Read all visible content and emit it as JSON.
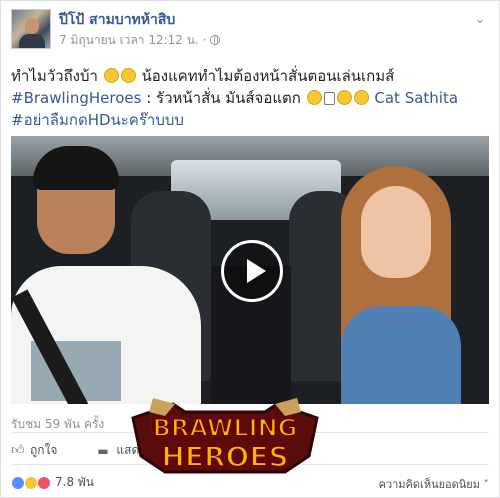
{
  "post": {
    "author": "ปีโป้ สามบาทห้าสิบ",
    "timestamp": "7 มิถุนายน เวลา 12:12 น. ·",
    "text": {
      "part1": "ทำไมวัวถึงบ้า ",
      "part2": " น้องแคททำไมต้องหน้าสั่นตอนเล่นเกมส์",
      "hashtag1": "#BrawlingHeroes",
      "part3": " : รัวหน้าสั่น มันส์จอแตก ",
      "mention": "Cat Sathita",
      "hashtag2": "#อย่าลืมกดHDนะคร๊าบบบ"
    }
  },
  "video": {
    "views": "รับชม 59 พัน ครั้ง"
  },
  "actions": {
    "like_label": "ถูกใจ",
    "share_label": "แสดง"
  },
  "reactions": {
    "count": "7.8 พัน"
  },
  "comments": {
    "sort_label": "ความคิดเห็นยอดนิยม ˅"
  },
  "banner": {
    "line1": "BRAWLING",
    "line2": "HEROES"
  },
  "colors": {
    "link": "#365899",
    "meta": "#90949c",
    "banner_gold": "#f5b800",
    "banner_red": "#9a1212"
  }
}
